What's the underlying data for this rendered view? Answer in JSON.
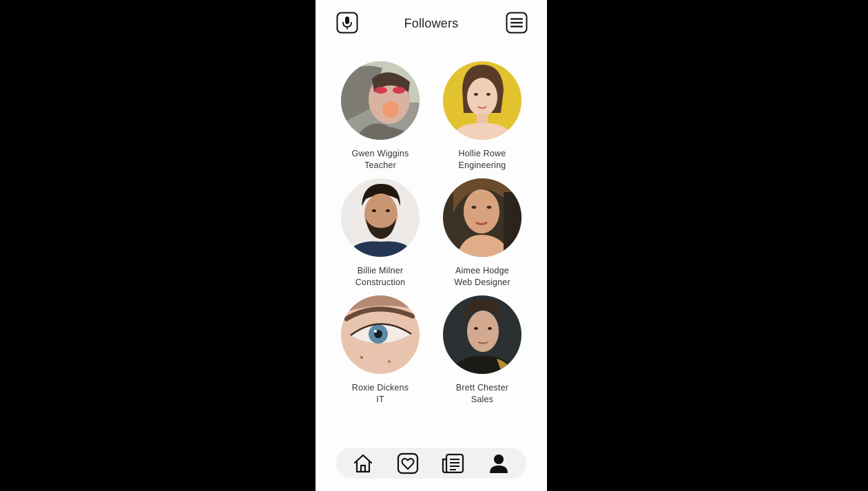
{
  "header": {
    "title": "Followers",
    "left_icon": "microphone-icon",
    "right_icon": "menu-icon"
  },
  "followers": [
    {
      "name": "Gwen Wiggins",
      "role": "Teacher"
    },
    {
      "name": "Hollie Rowe",
      "role": "Engineering"
    },
    {
      "name": "Billie Milner",
      "role": "Construction"
    },
    {
      "name": "Aimee Hodge",
      "role": "Web Designer"
    },
    {
      "name": "Roxie Dickens",
      "role": "IT"
    },
    {
      "name": "Brett Chester",
      "role": "Sales"
    }
  ],
  "nav": {
    "items": [
      "home-icon",
      "favorites-icon",
      "news-icon",
      "profile-icon"
    ],
    "active": "profile-icon"
  }
}
